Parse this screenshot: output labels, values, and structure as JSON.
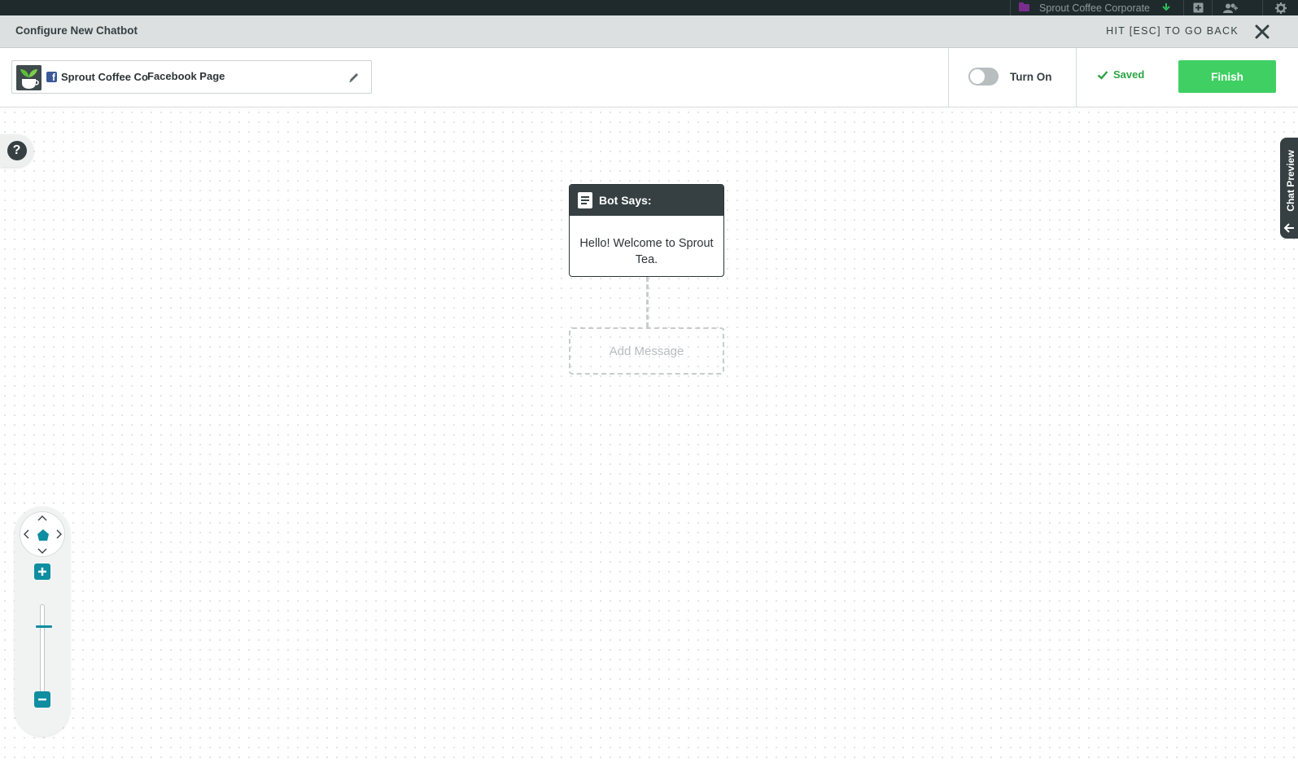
{
  "topbar": {
    "account_name": "Sprout Coffee Corporate",
    "icons": [
      "folder-icon",
      "chevron-down-icon",
      "compose-icon",
      "users-icon",
      "gear-icon"
    ]
  },
  "header": {
    "title": "Configure New Chatbot",
    "esc_hint": "HIT [ESC] TO GO BACK",
    "close_icon": "close-icon"
  },
  "toolbar": {
    "page_name": "Sprout Coffee Co",
    "page_type": "Facebook Page",
    "facebook_glyph": "f",
    "toggle_label": "Turn On",
    "toggle_on": false,
    "saved_label": "Saved",
    "finish_label": "Finish",
    "colors": {
      "finish": "#3fcf63",
      "saved": "#29a543",
      "facebook": "#3b5998"
    }
  },
  "canvas": {
    "help_glyph": "?",
    "chat_preview_label": "Chat Preview",
    "node": {
      "title": "Bot Says:",
      "message": "Hello! Welcome to Sprout Tea."
    },
    "add_message_label": "Add Message"
  },
  "zoom": {
    "level": 0.77,
    "accent": "#0e8ea0"
  }
}
